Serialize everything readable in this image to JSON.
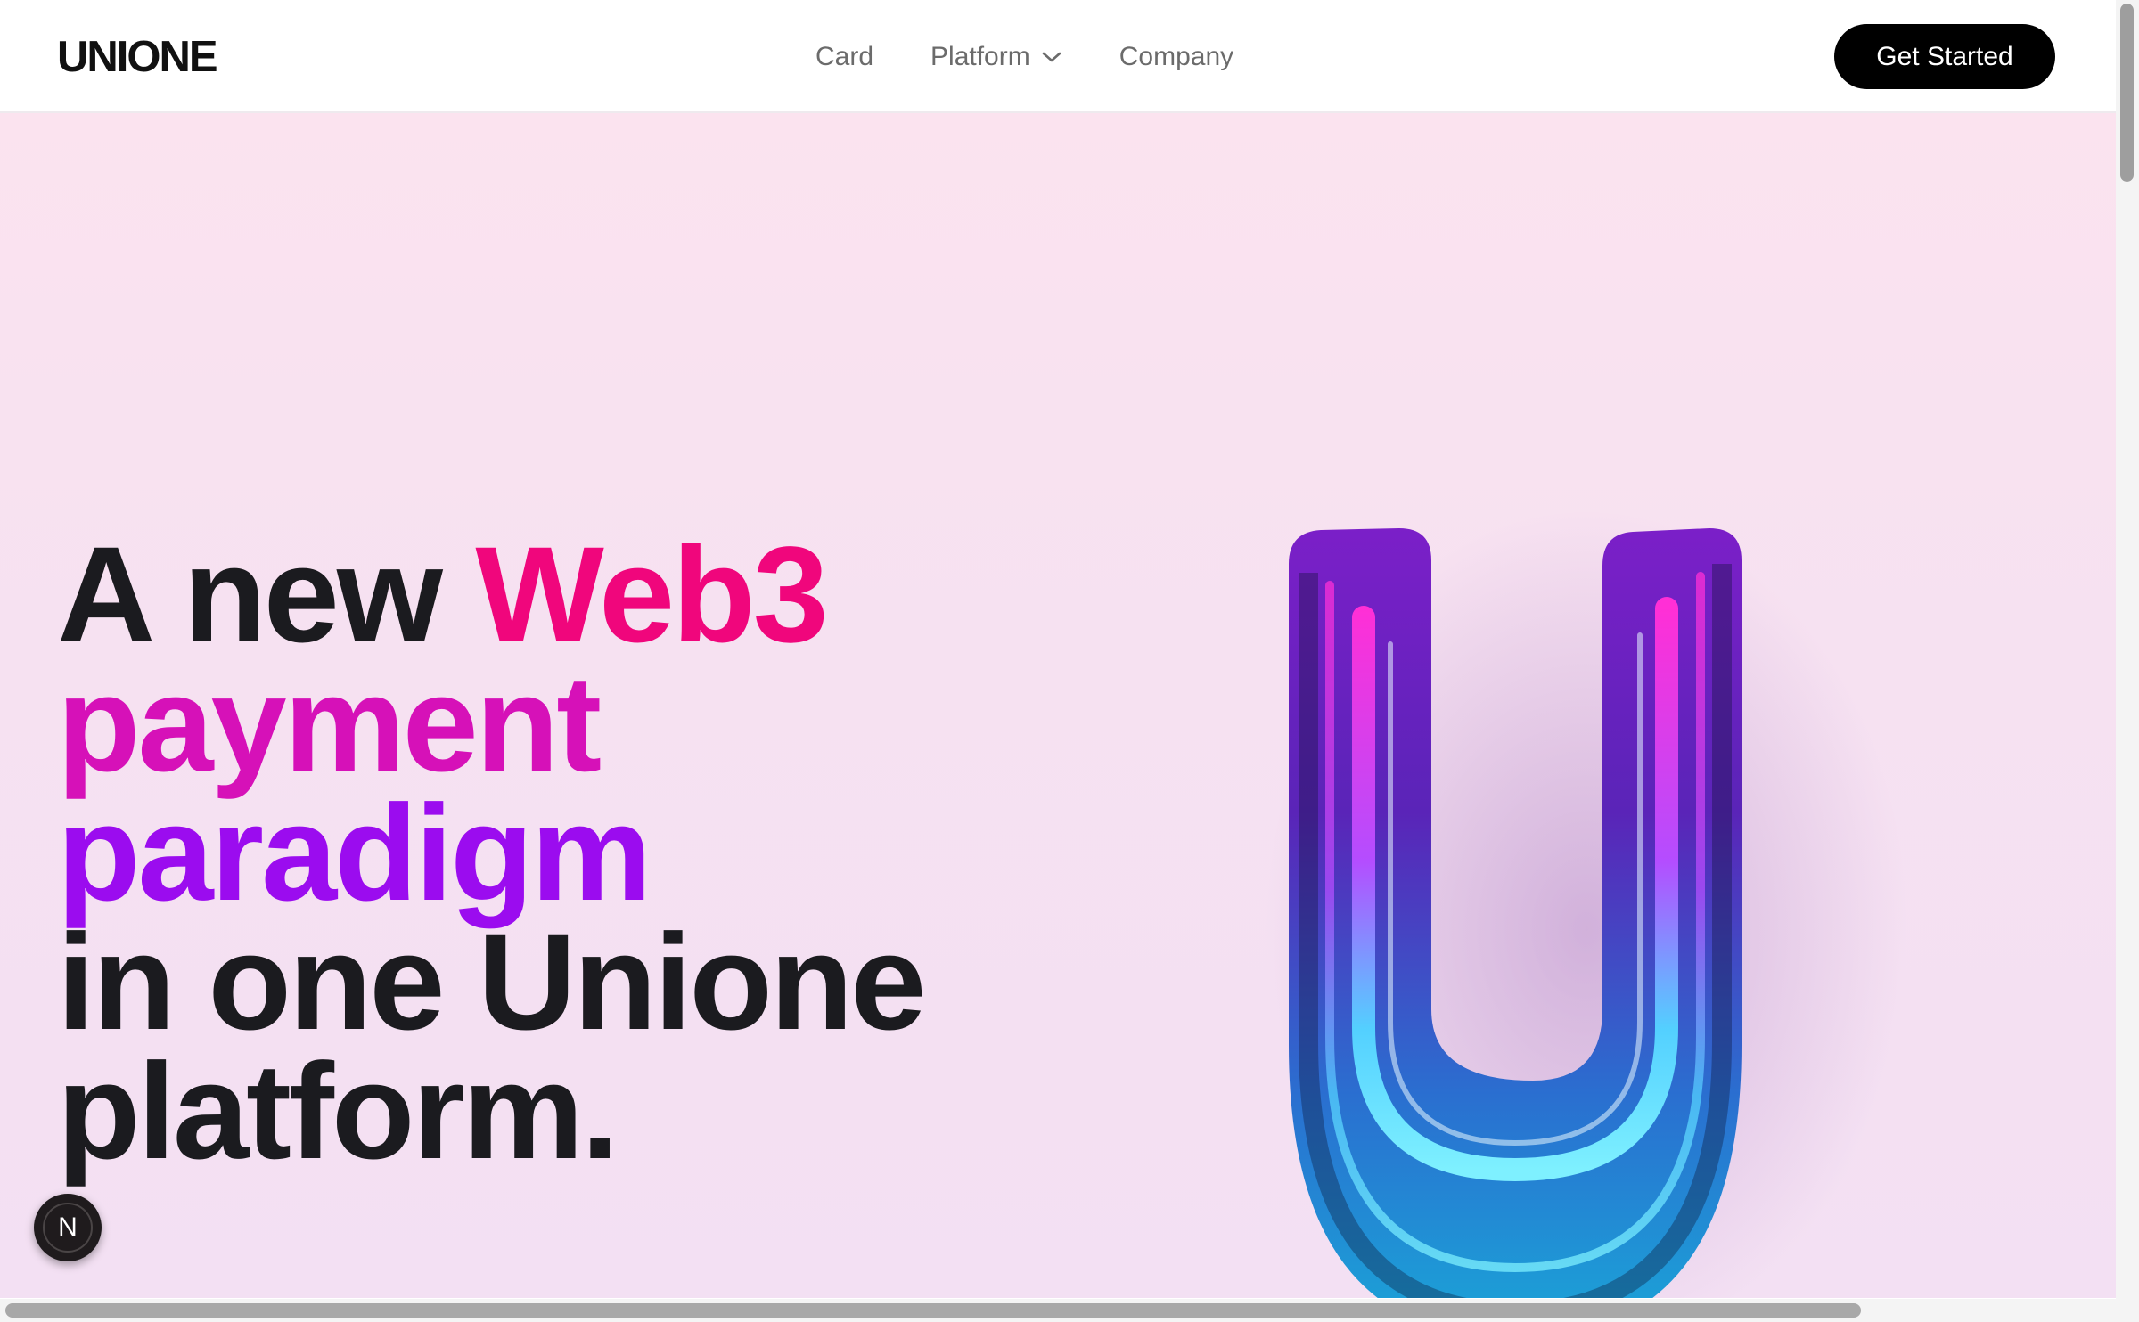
{
  "brand": {
    "name": "UNIONE"
  },
  "nav": {
    "items": [
      {
        "label": "Card"
      },
      {
        "label": "Platform",
        "has_dropdown": true
      },
      {
        "label": "Company"
      }
    ],
    "cta_label": "Get Started"
  },
  "hero": {
    "headline_lines": [
      {
        "text": "A new",
        "color": "#1b1b1f"
      },
      {
        "text": "Web3",
        "color": "#f0067c"
      },
      {
        "text": "payment",
        "color": "#d611b8"
      },
      {
        "text": "paradigm",
        "color": "#9b0cef"
      },
      {
        "text": "in one Unione",
        "color": "#1b1b1f"
      },
      {
        "text": "platform.",
        "color": "#1b1b1f"
      }
    ],
    "graphic": "3d-neon-u-letter-logo"
  },
  "dev_badge": {
    "glyph": "N",
    "icon": "nextjs-logo-icon"
  },
  "colors": {
    "accent_pink": "#f0067c",
    "accent_purple": "#9b0cef",
    "cta_bg": "#000000"
  }
}
